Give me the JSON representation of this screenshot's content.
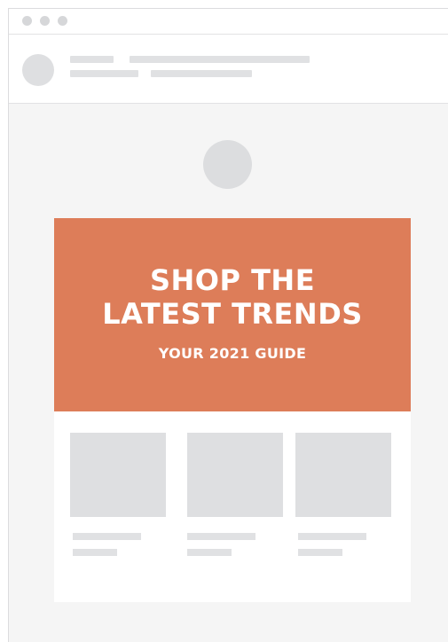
{
  "window": {
    "controls": [
      "window-dot-1",
      "window-dot-2",
      "window-dot-3"
    ]
  },
  "email": {
    "hero": {
      "title": "SHOP THE\nLATEST TRENDS",
      "subtitle": "YOUR 2021 GUIDE",
      "background_color": "#dd7d59"
    },
    "products": [
      {
        "name": "product-1"
      },
      {
        "name": "product-2"
      },
      {
        "name": "product-3"
      }
    ]
  },
  "colors": {
    "placeholder": "#e0e1e3",
    "canvas": "#f5f5f5",
    "accent": "#dd7d59"
  }
}
